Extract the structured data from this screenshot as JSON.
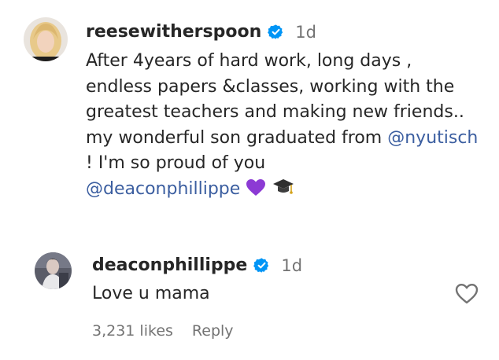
{
  "comments": [
    {
      "username": "reesewitherspoon",
      "verified": true,
      "time": "1d",
      "text_before": "After 4years of hard work, long days , endless papers &classes, working with the greatest teachers and making new friends.. my wonderful son graduated from ",
      "mention1": "@nyutisch",
      "text_middle": " ! I'm so proud of you ",
      "mention2": "@deaconphillippe",
      "emojis": [
        "purple-heart",
        "graduation-cap"
      ]
    },
    {
      "username": "deaconphillippe",
      "verified": true,
      "time": "1d",
      "text": "Love u mama",
      "likes": "3,231 likes",
      "reply_label": "Reply"
    }
  ],
  "colors": {
    "mention": "#3b5ea0",
    "verified": "#0095f6",
    "muted": "#737373",
    "purple_heart": "#8c3ad4"
  }
}
